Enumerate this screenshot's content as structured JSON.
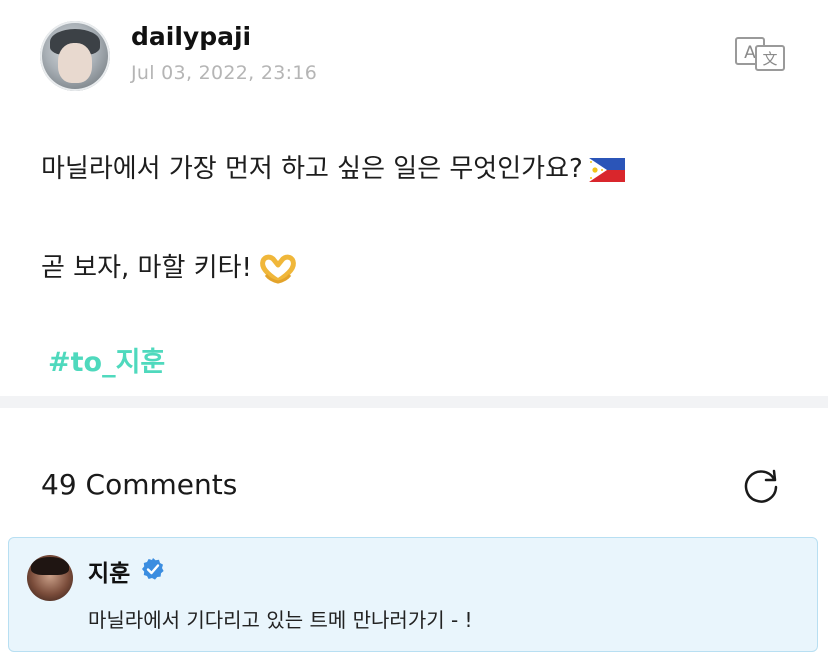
{
  "post": {
    "username": "dailypaji",
    "date": "Jul 03, 2022, 23:16",
    "line1": "마닐라에서 가장 먼저 하고 싶은 일은 무엇인가요?",
    "line2": "곧 보자, 마할 키타!",
    "hashtag": "#to_지훈"
  },
  "comments": {
    "title": "49 Comments",
    "items": [
      {
        "author": "지훈",
        "verified": true,
        "text": "마닐라에서 기다리고 있는 트메 만나러가기 - !"
      }
    ]
  },
  "icons": {
    "translate": "translate-icon",
    "refresh": "refresh-icon",
    "verified": "verified-badge-icon",
    "flag": "philippines-flag-icon",
    "hearts": "heart-hands-icon"
  },
  "colors": {
    "hashtag": "#4fd9bd",
    "verified": "#3b8de0",
    "highlight_bg": "#e9f5fc",
    "highlight_border": "#b8dff2",
    "date": "#b5b5b5"
  }
}
